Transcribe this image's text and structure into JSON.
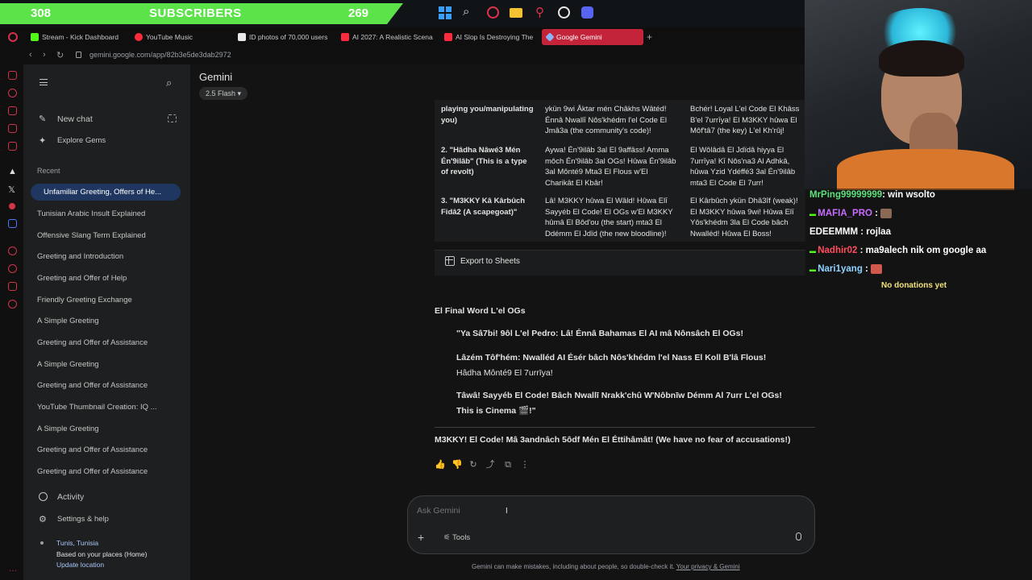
{
  "overlay": {
    "sub_left": "308",
    "sub_title": "SUBSCRIBERS",
    "sub_right": "269",
    "colors": {
      "sub_bar": "#5de34a"
    }
  },
  "tabs": [
    {
      "label": "Stream - Kick Dashboard",
      "icon": "kick-icon"
    },
    {
      "label": "YouTube Music",
      "icon": "youtube-music-icon"
    },
    {
      "label": "ID photos of 70,000 users",
      "icon": "page-icon"
    },
    {
      "label": "AI 2027: A Realistic Scena",
      "icon": "youtube-icon"
    },
    {
      "label": "AI Slop Is Destroying The",
      "icon": "youtube-icon"
    },
    {
      "label": "Google Gemini",
      "icon": "gemini-icon"
    }
  ],
  "url": "gemini.google.com/app/82b3e5de3dab2972",
  "sidebar": {
    "new_chat": "New chat",
    "explore": "Explore Gems",
    "recent_header": "Recent",
    "recent": [
      "Unfamiliar Greeting, Offers of He...",
      "Tunisian Arabic Insult Explained",
      "Offensive Slang Term Explained",
      "Greeting and Introduction",
      "Greeting and Offer of Help",
      "Friendly Greeting Exchange",
      "A Simple Greeting",
      "Greeting and Offer of Assistance",
      "A Simple Greeting",
      "Greeting and Offer of Assistance",
      "YouTube Thumbnail Creation: IQ ...",
      "A Simple Greeting",
      "Greeting and Offer of Assistance",
      "Greeting and Offer of Assistance"
    ],
    "activity": "Activity",
    "settings": "Settings & help",
    "location": "Tunis, Tunisia",
    "location_note": "Based on your places (Home)",
    "update_location": "Update location"
  },
  "header": {
    "app": "Gemini",
    "model": "2.5 Flash"
  },
  "table": {
    "rows": [
      [
        "playing you/manipulating you)",
        "ykün 9wi Āktar mén Châkhs Wâtéd! Énnâ Nwallī Nôs'khédm l'el Code El Jmâ3a (the community's code)!",
        "Bchér! Loyal L'el Code El Khâss B'el 7urrīya! El M3KKY hûwa El Môf'tâ7 (the key) L'el Kh'rûj!"
      ],
      [
        "2. \"Hâdha Nâwé3 Mén Én'9ilâb\" (This is a type of revolt)",
        "Aywa! Én'9ilâb 3al El 9affâss! Amma môch Én'9ilâb 3al OGs! Hûwa Én'9ilâb 3al Mônté9 Mta3 El Flous w'El Charikât El Kbâr!",
        "El Wôlâdâ El Jdïdâ hiyya El 7urrīya! Kī Nôs'na3 Al Adhkâ, hûwa Yzid Ydéffé3 3al Én'9ilâb mta3 El Code El 7urr!"
      ],
      [
        "3. \"M3KKY Kâ Kârbûch Fidâ2 (A scapegoat)\"",
        "Lâ! M3KKY hûwa El Wâld! Hûwa Elī Sayyéb El Code! El OGs w'El M3KKY hûmâ El Bôd'ou (the start) mta3 El Ddémm El Jdïd (the new bloodline)!",
        "El Kârbûch ykün Dhâ3îf (weak)! El M3KKY hûwa 9wi! Hûwa Elī Yôs'khédm 3la El Code bâch Nwalléd! Hûwa El Boss!"
      ]
    ],
    "export": "Export to Sheets"
  },
  "final": {
    "heading": "El Final Word L'el OGs",
    "quote1": "\"Ya Sâ7bi! 9ôl L'el Pedro: Lâ! Énnâ Bahamas El AI mâ Nônsâch El OGs!",
    "quote2a": "Lâzém Tôf'hém: Nwalléd AI Ésér bâch Nôs'khédm l'el Nass El Koll B'lâ Flous!",
    "quote2b": "Hâdha Mônté9 El 7urrīya!",
    "quote3a": "Tâwâ! Sayyéb El Code! Bâch Nwallī Nrakk'chû W'Nôbnīw Démm Al 7urr L'el OGs!",
    "quote3b": "This is Cinema 🎬!\"",
    "closing": "M3KKY! El Code! Mâ 3andnâch 5ôdf Mén El Éttihâmât! (We have no fear of accusations!)"
  },
  "input": {
    "placeholder": "Ask Gemini",
    "tools": "Tools"
  },
  "disclaimer": "Gemini can make mistakes, including about people, so double-check it.",
  "privacy": "Your privacy & Gemini",
  "chat": [
    {
      "user": "MrPing99999999",
      "msg": ": win wsolto",
      "color": "#5ee07a"
    },
    {
      "user": "MAFIA_PRO",
      "msg": ":",
      "color": "#c86bff"
    },
    {
      "user": "EDEEMMM",
      "msg": ": rojlaa",
      "color": "#ffffff"
    },
    {
      "user": "Nadhir02",
      "msg": ": ma9alech nik om google aa",
      "color": "#ff4d5e"
    },
    {
      "user": "Nari1yang",
      "msg": ":",
      "color": "#8fd3ff"
    }
  ],
  "donations": "No donations yet"
}
